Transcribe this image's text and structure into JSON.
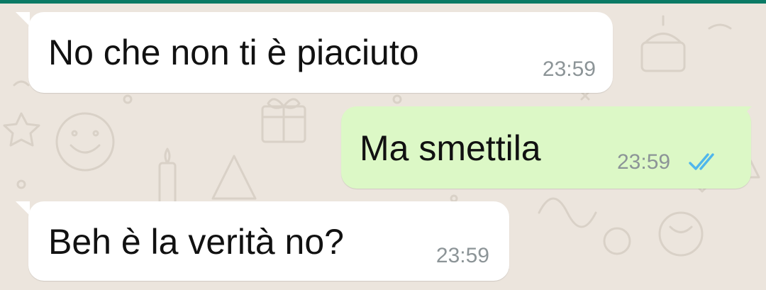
{
  "colors": {
    "wallpaper": "#ECE5DD",
    "accent_bar": "#0B7A65",
    "incoming_bubble": "#FFFFFF",
    "outgoing_bubble": "#DCF8C6",
    "timestamp": "#8C9497",
    "read_ticks": "#4FB6EC"
  },
  "messages": [
    {
      "direction": "incoming",
      "text": "No che non ti è piaciuto",
      "time": "23:59"
    },
    {
      "direction": "outgoing",
      "text": "Ma smettila",
      "time": "23:59",
      "status_icon": "double-check-read-icon"
    },
    {
      "direction": "incoming",
      "text": "Beh è la verità no?",
      "time": "23:59"
    }
  ]
}
